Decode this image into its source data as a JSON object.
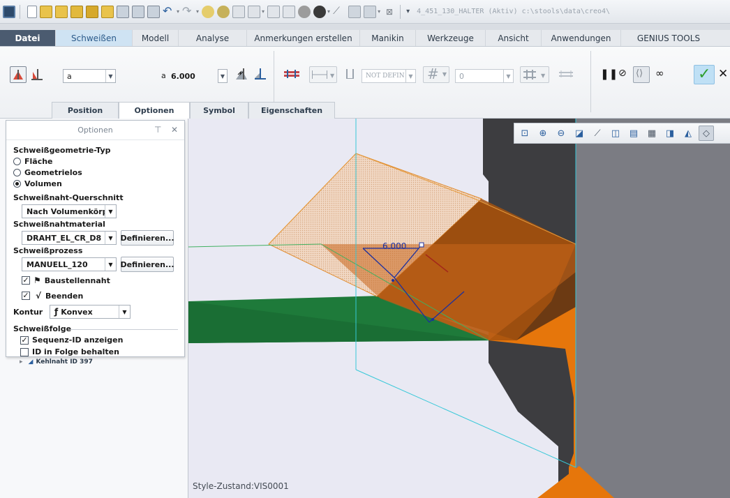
{
  "window": {
    "title": "4_451_130_HALTER (Aktiv) c:\\stools\\data\\creo4\\"
  },
  "quick_access": {
    "icons": [
      "app-icon",
      "new-icon",
      "open-icon",
      "open-folder-icon",
      "open-folder-2-icon",
      "open-folder-3-icon",
      "save-icon",
      "save-copy-icon",
      "save-backup-icon",
      "undo-icon",
      "redo-icon",
      "regenerate-icon",
      "regenerate-2-icon",
      "model-tree-icon",
      "datum-icon",
      "tools-icon",
      "layers-icon",
      "appearance-icon",
      "render-icon",
      "measure-icon",
      "sketch-icon",
      "windows-icon",
      "close-window-icon",
      "customize-icon"
    ]
  },
  "menubar": {
    "tabs": [
      {
        "label": "Datei",
        "state": "file"
      },
      {
        "label": "Schweißen",
        "state": "active"
      },
      {
        "label": "Modell",
        "state": ""
      },
      {
        "label": "Analyse",
        "state": ""
      },
      {
        "label": "Anmerkungen erstellen",
        "state": ""
      },
      {
        "label": "Manikin",
        "state": ""
      },
      {
        "label": "Werkzeuge",
        "state": ""
      },
      {
        "label": "Ansicht",
        "state": ""
      },
      {
        "label": "Anwendungen",
        "state": ""
      },
      {
        "label": "GENIUS TOOLS",
        "state": ""
      }
    ]
  },
  "ribbon": {
    "weld_type_combo": "a",
    "a_label": "a",
    "a_value": "6.000",
    "symbol_combo": "NOT DEFIN",
    "count_combo": "0",
    "subtabs": [
      {
        "label": "Position",
        "active": false
      },
      {
        "label": "Optionen",
        "active": true
      },
      {
        "label": "Symbol",
        "active": false
      },
      {
        "label": "Eigenschaften",
        "active": false
      }
    ],
    "ok_color": "#2f9e2f",
    "cancel_color": "#1a1a1a"
  },
  "options_panel": {
    "title": "Optionen",
    "geometry_type": {
      "title": "Schweißgeometrie-Typ",
      "options": [
        {
          "label": "Fläche",
          "selected": false
        },
        {
          "label": "Geometrielos",
          "selected": false
        },
        {
          "label": "Volumen",
          "selected": true
        }
      ]
    },
    "cross_section": {
      "title": "Schweißnaht-Querschnitt",
      "value": "Nach Volumenkörper"
    },
    "material": {
      "title": "Schweißnahtmaterial",
      "value": "DRAHT_EL_CR_D8",
      "define_label": "Definieren..."
    },
    "process": {
      "title": "Schweißprozess",
      "value": "MANUELL_120",
      "define_label": "Definieren..."
    },
    "site_weld": {
      "label": "Baustellennaht",
      "checked": true
    },
    "finish": {
      "label": "Beenden",
      "checked": true
    },
    "contour": {
      "label": "Kontur",
      "value": "Konvex"
    },
    "sequence": {
      "title": "Schweißfolge",
      "show_id": {
        "label": "Sequenz-ID anzeigen",
        "checked": true
      },
      "keep_id": {
        "label": "ID in Folge behalten",
        "checked": false
      }
    }
  },
  "model_tree": {
    "partial_item": "Kehlnaht ID 397"
  },
  "viewport": {
    "dimension_value": "6.000",
    "style_status": "Style-Zustand:VIS0001",
    "toolbar_icons": [
      "refit-icon",
      "zoom-in-icon",
      "zoom-out-icon",
      "repaint-icon",
      "spin-center-icon",
      "display-style-icon",
      "saved-orientations-icon",
      "view-manager-icon",
      "datum-display-icon",
      "annotation-display-icon",
      "filter-icon"
    ]
  }
}
